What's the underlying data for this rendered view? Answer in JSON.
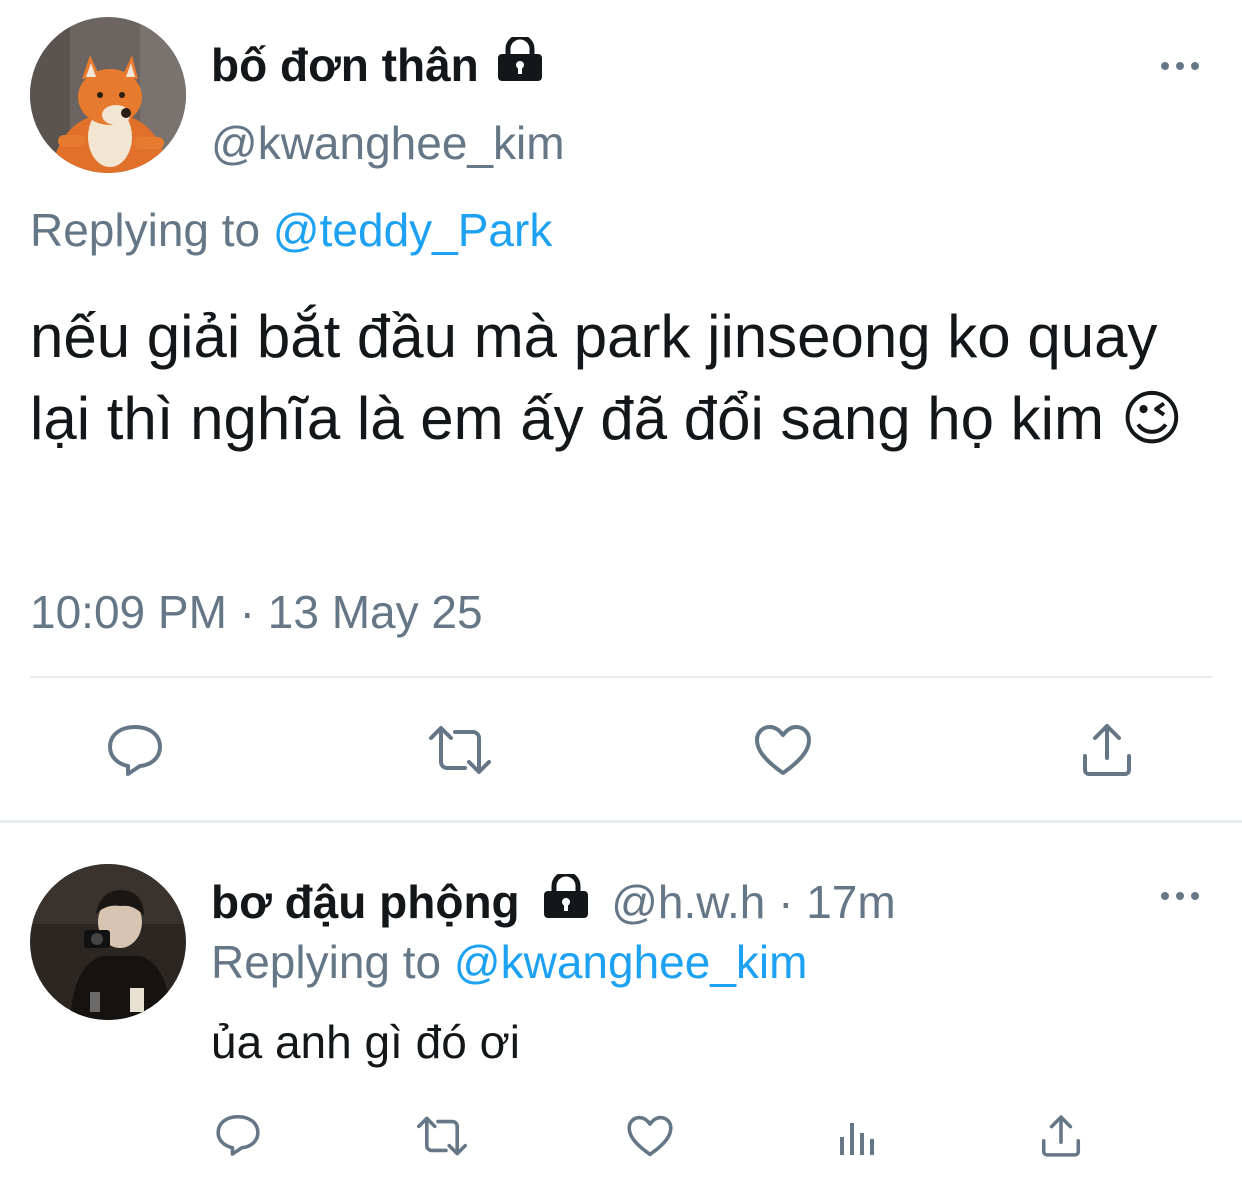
{
  "main_tweet": {
    "display_name": "bố đơn thân",
    "handle": "@kwanghee_kim",
    "replying_to_label": "Replying to",
    "replying_to_handle": "@teddy_Park",
    "text": "nếu giải bắt đầu mà park jinseong ko quay lại thì nghĩa là em ấy đã đổi sang họ kim",
    "emoji": "😉",
    "timestamp": "10:09 PM · 13 May 25",
    "locked": true,
    "icons": {
      "more": "more-dots-icon",
      "lock": "lock-icon",
      "reply": "reply-icon",
      "retweet": "retweet-icon",
      "like": "heart-icon",
      "share": "share-icon"
    }
  },
  "reply_tweet": {
    "display_name": "bơ đậu phộng",
    "handle": "@h.w.h",
    "separator": "·",
    "time": "17m",
    "replying_to_label": "Replying to",
    "replying_to_handle": "@kwanghee_kim",
    "text": "ủa anh gì đó ơi",
    "locked": true,
    "icons": {
      "more": "more-dots-icon",
      "lock": "lock-icon",
      "reply": "reply-icon",
      "retweet": "retweet-icon",
      "like": "heart-icon",
      "analytics": "analytics-icon",
      "share": "share-icon"
    }
  },
  "colors": {
    "text": "#14171a",
    "muted": "#657786",
    "link": "#1da1f2",
    "divider": "#e6ecf0"
  }
}
